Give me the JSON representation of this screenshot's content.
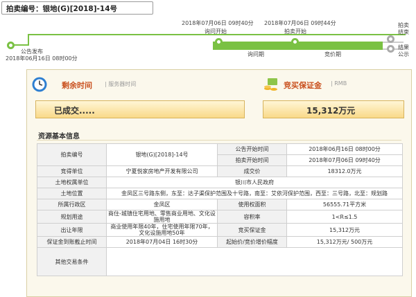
{
  "auction_no": "拍卖编号：银地(G)[2018]-14号",
  "timeline": {
    "public_notice": {
      "date": "2018年06月16日 08时00分",
      "label": "公告发布"
    },
    "inquiry_start": {
      "date": "2018年07月06日 09时40分",
      "label": "询问开始"
    },
    "inquiry_period": "询问期",
    "auction_start": {
      "date": "2018年07月06日 09时44分",
      "label": "拍卖开始"
    },
    "bid_period": "竞价期",
    "right_top": "拍卖\n结束",
    "right_bottom": "结果\n公示"
  },
  "remaining": {
    "title": "剩余时间",
    "sub": "| 服务器时间",
    "status": "已成交....."
  },
  "deposit": {
    "title": "竞买保证金",
    "sub": "| RMB",
    "amount": "15,312万元"
  },
  "resource": {
    "title": "资源基本信息",
    "rows": [
      {
        "l1": "拍卖编号",
        "v1": "银地(G)[2018]-14号",
        "l2": "公告开始时间",
        "v2": "2018年06月16日 08时00分"
      },
      {
        "l2b": "拍卖开始时间",
        "v2b": "2018年07月06日 09时40分"
      },
      {
        "l1": "竞得单位",
        "v1": "宁夏悦家房地产开发有限公司",
        "l2": "成交价",
        "v2": "18312.0万元"
      },
      {
        "l1": "土地权属单位",
        "v1": "银川市人民政府"
      },
      {
        "l1": "土地位置",
        "v1": "金凤区三号路东侧，东至：达子渠保护范围及十号路，南至：艾依河保护范围，西至：三号路，北至：规划路"
      },
      {
        "l1": "所属行政区",
        "v1": "金凤区",
        "l2": "使用权面积",
        "v2": "56555.71平方米"
      },
      {
        "l1": "规划用途",
        "v1": "商住-城镇住宅用地、零售商业用地、文化设施用地",
        "l2": "容积率",
        "v2": "1<R≤1.5"
      },
      {
        "l1": "出让年限",
        "v1": "商业使用年限40年，住宅使用年限70年，文化设施用地50年",
        "l2": "竞买保证金",
        "v2": "15,312万元"
      },
      {
        "l1": "保证金到账截止时间",
        "v1": "2018年07月04日 16时30分",
        "l2": "起始价/竞价增价幅度",
        "v2": "15,312万元/ 500万元"
      },
      {
        "l1": "其他交易条件",
        "v1": ""
      }
    ]
  }
}
